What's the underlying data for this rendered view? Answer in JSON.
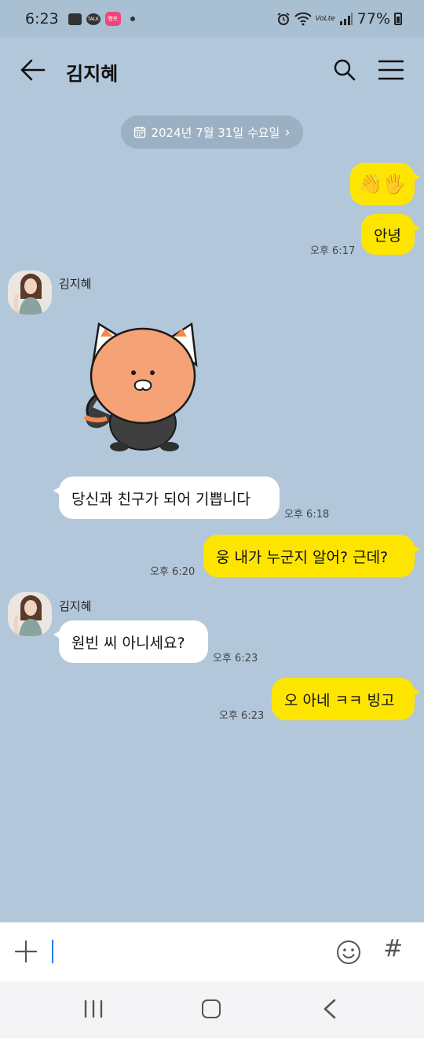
{
  "status_bar": {
    "time": "6:23",
    "talk_badge": "TALK",
    "app_badge": "쨩프",
    "volte": "VoLte",
    "battery": "77%"
  },
  "header": {
    "title": "김지혜",
    "back_icon": "arrow-left-icon",
    "search_icon": "search-icon",
    "menu_icon": "hamburger-menu-icon"
  },
  "date_divider": {
    "label": "2024년 7월 31일 수요일",
    "icon": "calendar-icon",
    "chevron": "›"
  },
  "messages": [
    {
      "from": "me",
      "text": "👋🖐",
      "time": ""
    },
    {
      "from": "me",
      "text": "안녕",
      "time": "오후 6:17"
    },
    {
      "from": "other",
      "sender": "김지혜",
      "sticker": "orange-cat-sticker"
    },
    {
      "from": "other",
      "text": "당신과 친구가 되어 기쁩니다",
      "time": "오후 6:18"
    },
    {
      "from": "me",
      "text": "웅 내가 누군지 알어? 근데?",
      "time": "오후 6:20"
    },
    {
      "from": "other",
      "sender": "김지혜",
      "text": "원빈 씨 아니세요?",
      "time": "오후 6:23"
    },
    {
      "from": "me",
      "text": "오 아네 ㅋㅋ 빙고",
      "time": "오후 6:23"
    }
  ],
  "input": {
    "value": "",
    "plus_icon": "plus-icon",
    "emoji_icon": "emoji-icon",
    "hash_label": "#"
  },
  "nav": {
    "recent_icon": "recent-apps-icon",
    "home_icon": "home-icon",
    "back_icon": "back-chevron-icon"
  },
  "colors": {
    "chat_background": "#b2c7da",
    "my_bubble": "#fee500",
    "other_bubble": "#ffffff"
  }
}
